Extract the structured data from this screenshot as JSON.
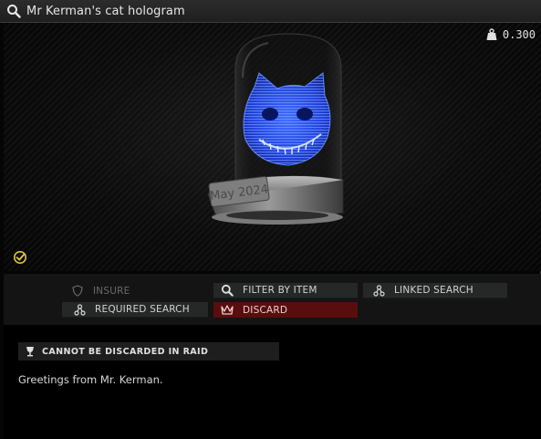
{
  "window": {
    "title": "Mr Kerman's cat hologram",
    "title_icon": "search-icon"
  },
  "preview": {
    "weight": "0.300",
    "weight_icon": "weight-icon",
    "base_engraving": "May 2024",
    "found_in_raid_icon": "checkmark-badge-icon",
    "hologram_color": "#2a55ff"
  },
  "actions": {
    "insure": {
      "label": "INSURE",
      "icon": "shield-icon",
      "enabled": false
    },
    "filter_by_item": {
      "label": "FILTER BY ITEM",
      "icon": "search-icon"
    },
    "linked_search": {
      "label": "LINKED SEARCH",
      "icon": "linked-nodes-icon"
    },
    "required_search": {
      "label": "REQUIRED SEARCH",
      "icon": "linked-nodes-icon"
    },
    "discard": {
      "label": "DISCARD",
      "icon": "crown-icon",
      "color": "#5a0d0d"
    }
  },
  "restriction": {
    "text": "CANNOT BE DISCARDED IN RAID",
    "icon": "goblet-icon"
  },
  "description": "Greetings from Mr. Kerman."
}
